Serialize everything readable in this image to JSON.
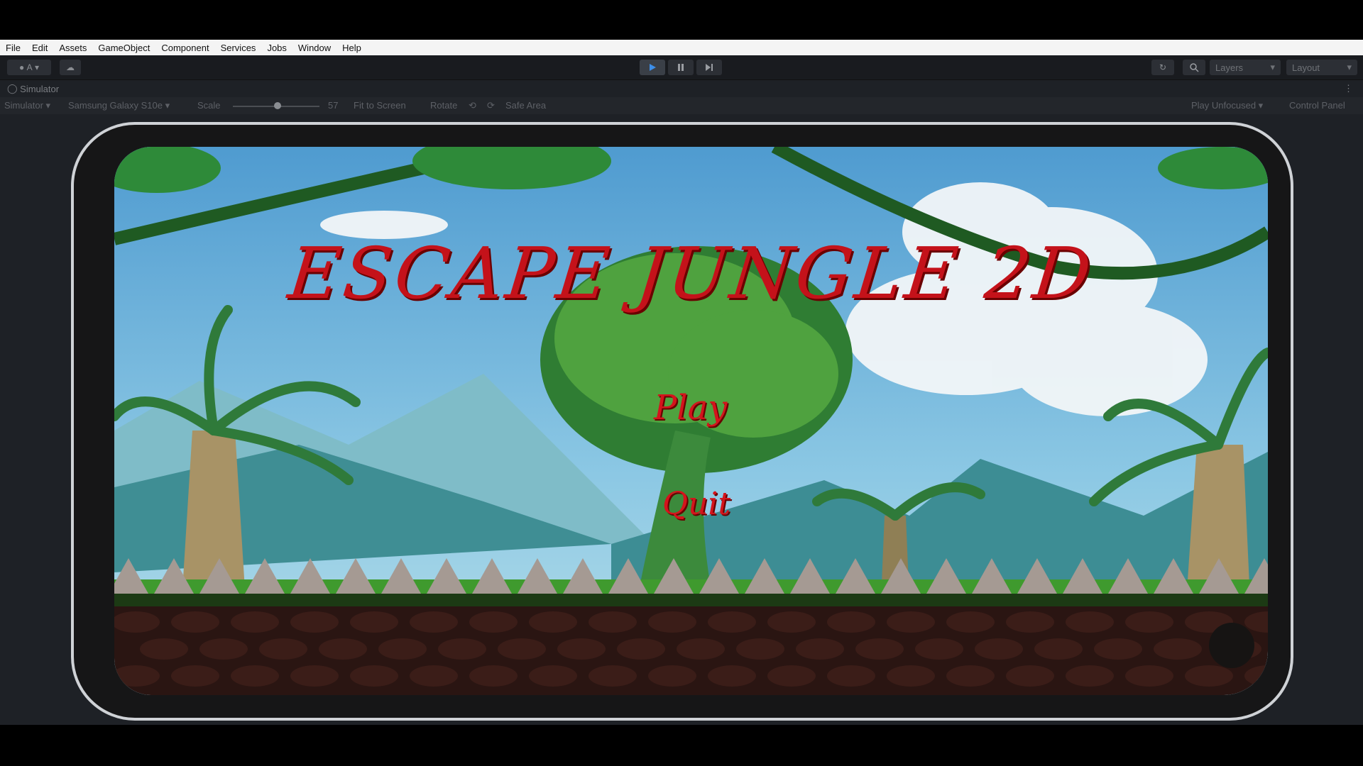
{
  "menu": [
    "File",
    "Edit",
    "Assets",
    "GameObject",
    "Component",
    "Services",
    "Jobs",
    "Window",
    "Help"
  ],
  "toolbar": {
    "account_label": "A",
    "layers_label": "Layers",
    "layout_label": "Layout"
  },
  "simulator_tab": "Simulator",
  "simbar": {
    "mode": "Simulator",
    "device": "Samsung Galaxy S10e",
    "scale_label": "Scale",
    "scale_value": "57",
    "fit": "Fit to Screen",
    "rotate": "Rotate",
    "safe_area": "Safe Area",
    "play_mode": "Play Unfocused",
    "control_panel": "Control Panel"
  },
  "game": {
    "title": "ESCAPE JUNGLE 2D",
    "play": "Play",
    "quit": "Quit"
  },
  "icons": [
    "account-icon",
    "cloud-icon",
    "play-icon",
    "pause-icon",
    "step-icon",
    "history-icon",
    "search-icon",
    "rotate-left-icon",
    "rotate-right-icon",
    "more-icon"
  ]
}
